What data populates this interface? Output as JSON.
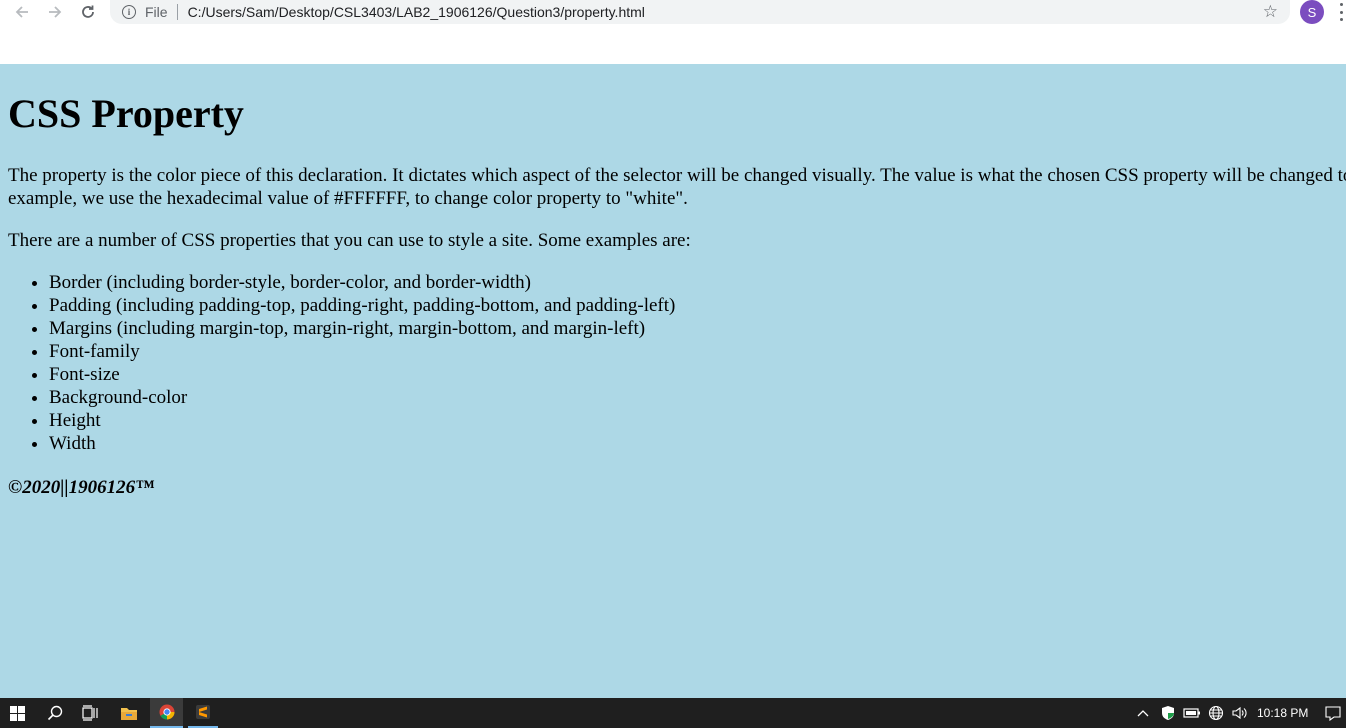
{
  "browser": {
    "back_icon": "arrow-left-icon",
    "forward_icon": "arrow-right-icon",
    "reload_icon": "reload-icon",
    "scheme_label": "File",
    "url": "C:/Users/Sam/Desktop/CSL3403/LAB2_1906126/Question3/property.html",
    "bookmark_icon": "star-icon",
    "profile_initial": "S",
    "profile_color": "#7b4dbf"
  },
  "page": {
    "background_color": "#add8e6",
    "heading": "CSS Property",
    "paragraph1": "The property is the color piece of this declaration. It dictates which aspect of the selector will be changed visually. The value is what the chosen CSS property will be changed to.for example, we use the hexadecimal value of #FFFFFF, to change color property to \"white\".",
    "paragraph2": "There are a number of CSS properties that you can use to style a site. Some examples are:",
    "list": [
      "Border (including border-style, border-color, and border-width)",
      "Padding (including padding-top, padding-right, padding-bottom, and padding-left)",
      "Margins (including margin-top, margin-right, margin-bottom, and margin-left)",
      "Font-family",
      "Font-size",
      "Background-color",
      "Height",
      "Width"
    ],
    "footer": "©2020||1906126™"
  },
  "taskbar": {
    "start_icon": "windows-logo-icon",
    "search_icon": "search-icon",
    "taskview_icon": "task-view-icon",
    "apps": [
      "file-explorer-icon",
      "chrome-icon",
      "sublime-text-icon"
    ],
    "clock": "10:18 PM",
    "background_color": "#1f1f1f"
  }
}
